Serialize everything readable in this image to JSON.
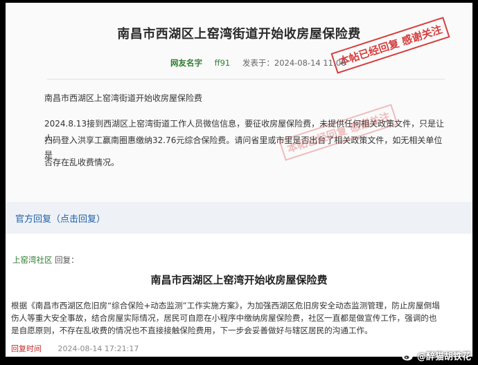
{
  "post": {
    "title": "南昌市西湖区上窑湾街道开始收房屋保险费",
    "author_label": "网友名字",
    "author": "ff91",
    "time": "发表于：2024-08-14 11:06",
    "stamp": "本帖已经回复 感谢关注",
    "body_title": "南昌市西湖区上窑湾街道开始收房屋保险费",
    "body_p1": "2024.8.13接到西湖区上窑湾街道工作人员微信信息，要征收房屋保险费，未提供任何相关政策文件，只是让人",
    "body_p2": "扫码登入洪享工赢南圈惠缴纳32.76元综合保险费。请问省里或市里是否出台了相关政策文件，如无相关单位是",
    "body_p3": "否存在乱收费情况。"
  },
  "official": {
    "header": "官方回复（点击回复）"
  },
  "reply": {
    "org": "上窑湾社区",
    "org_suffix": "回复：",
    "title": "南昌市西湖区上窑湾开始收房屋保险费",
    "line1": "根据《南昌市西湖区危旧房“综合保险+动态监测”工作实施方案》，为加强西湖区危旧房安全动态监测管理，防止房屋倒塌",
    "line2": "伤人等重大安全事故，结合房屋实际情况，居民可自愿在小程序中缴纳房屋保险费，社区一直都是做宣传工作，强调的也",
    "line3": "是自愿原则，不存在乱收费的情况也不直接接触保险费用，下一步会妥善做好与辖区居民的沟通工作。",
    "time_label": "回复时间",
    "time": "2024-08-14 17:21:17"
  },
  "watermark": {
    "text": "@醉猫胡铁花",
    "icon": "weibo-icon"
  },
  "colors": {
    "green": "#2e7d32",
    "stamp_red": "#d32f2f",
    "link_blue": "#1e5fa8"
  }
}
